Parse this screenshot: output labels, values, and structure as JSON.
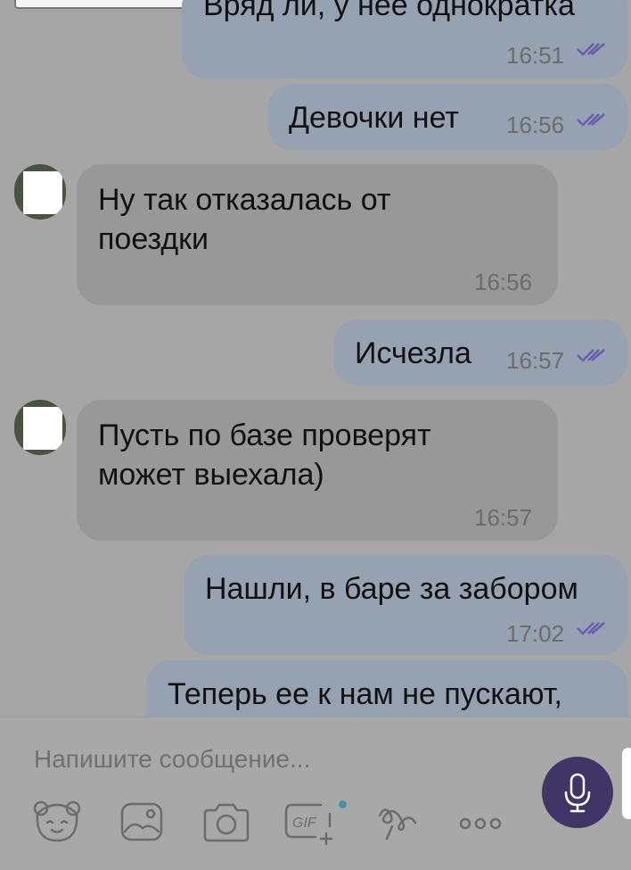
{
  "messages": [
    {
      "direction": "out",
      "text": "Вряд ли, у нее однократка",
      "time": "16:51",
      "read": true
    },
    {
      "direction": "out",
      "text": "Девочки нет",
      "time": "16:56",
      "read": true
    },
    {
      "direction": "in",
      "lines": [
        "Ну так отказалась от",
        "поездки"
      ],
      "time": "16:56"
    },
    {
      "direction": "out",
      "text": "Исчезла",
      "time": "16:57",
      "read": true
    },
    {
      "direction": "in",
      "lines": [
        "Пусть по базе проверят",
        "может выехала)"
      ],
      "time": "16:57"
    },
    {
      "direction": "out",
      "text": "Нашли, в баре за забором",
      "time": "17:02",
      "read": true
    },
    {
      "direction": "out",
      "text": "Теперь ее к нам не пускают,"
    }
  ],
  "composer": {
    "placeholder": "Напишите сообщение...",
    "tools": [
      {
        "icon": "sticker-bear-icon"
      },
      {
        "icon": "gallery-icon"
      },
      {
        "icon": "camera-icon"
      },
      {
        "icon": "gif-icon",
        "label": "GIF"
      },
      {
        "icon": "doodle-icon"
      },
      {
        "icon": "more-icon"
      }
    ],
    "action_icon": "microphone-icon"
  },
  "colors": {
    "outgoing_bubble": "#96a1b1",
    "incoming_bubble": "#989898",
    "read_ticks": "#6a5bb0",
    "mic_button": "#3f3566",
    "notification_dot": "#4e91a7"
  }
}
